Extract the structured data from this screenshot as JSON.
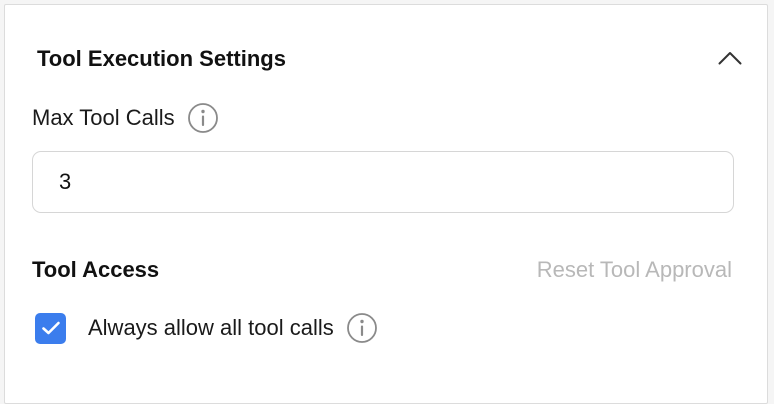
{
  "section": {
    "title": "Tool Execution Settings",
    "collapse_icon": "chevron-up-icon"
  },
  "max_tool_calls": {
    "label": "Max Tool Calls",
    "info_icon": "info-icon",
    "value": "3"
  },
  "tool_access": {
    "title": "Tool Access",
    "reset_label": "Reset Tool Approval",
    "checkbox": {
      "label": "Always allow all tool calls",
      "checked": true,
      "info_icon": "info-icon"
    }
  },
  "colors": {
    "accent": "#3b7ded",
    "disabled_text": "#b8b8b8",
    "border": "#d6d6d6"
  }
}
